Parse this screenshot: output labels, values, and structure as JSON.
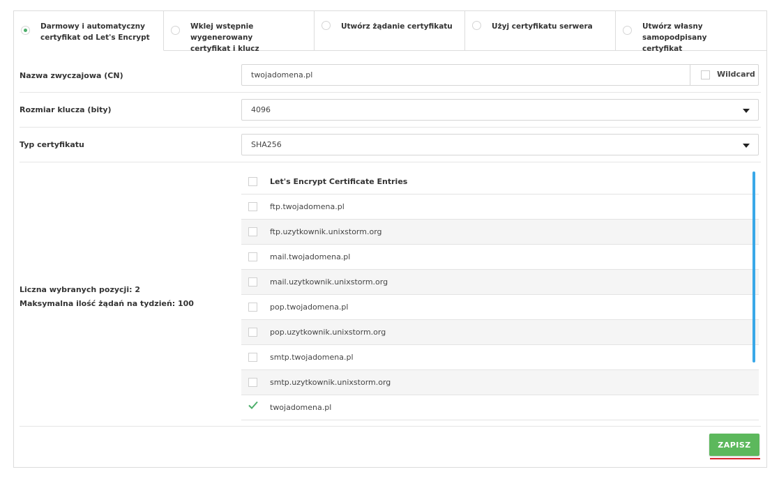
{
  "tabs": [
    {
      "label_line1": "Darmowy i automatyczny",
      "label_line2": "certyfikat od Let's Encrypt",
      "active": true
    },
    {
      "label_line1": "Wklej wstępnie wygenerowany",
      "label_line2": "certyfikat i klucz",
      "active": false
    },
    {
      "label_line1": "Utwórz żądanie certyfikatu",
      "label_line2": "",
      "active": false
    },
    {
      "label_line1": "Użyj certyfikatu serwera",
      "label_line2": "",
      "active": false
    },
    {
      "label_line1": "Utwórz własny samopodpisany",
      "label_line2": "certyfikat",
      "active": false
    }
  ],
  "form": {
    "common_name_label": "Nazwa zwyczajowa (CN)",
    "common_name_value": "twojadomena.pl",
    "wildcard_label": "Wildcard",
    "key_size_label": "Rozmiar klucza (bity)",
    "key_size_value": "4096",
    "cert_type_label": "Typ certyfikatu",
    "cert_type_value": "SHA256"
  },
  "list": {
    "header": "Let's Encrypt Certificate Entries",
    "items": [
      {
        "label": "ftp.twojadomena.pl",
        "checked": false
      },
      {
        "label": "ftp.uzytkownik.unixstorm.org",
        "checked": false
      },
      {
        "label": "mail.twojadomena.pl",
        "checked": false
      },
      {
        "label": "mail.uzytkownik.unixstorm.org",
        "checked": false
      },
      {
        "label": "pop.twojadomena.pl",
        "checked": false
      },
      {
        "label": "pop.uzytkownik.unixstorm.org",
        "checked": false
      },
      {
        "label": "smtp.twojadomena.pl",
        "checked": false
      },
      {
        "label": "smtp.uzytkownik.unixstorm.org",
        "checked": false
      },
      {
        "label": "twojadomena.pl",
        "checked": true
      }
    ]
  },
  "info": {
    "selected_count": "Liczna wybranych pozycji: 2",
    "max_requests": "Maksymalna ilość żądań na tydzień: 100"
  },
  "save_label": "ZAPISZ",
  "colors": {
    "accent_green": "#5cb85c",
    "radio_active": "#4cae6a",
    "scrollbar": "#3aa8e8",
    "underline_red": "#d9262e"
  }
}
